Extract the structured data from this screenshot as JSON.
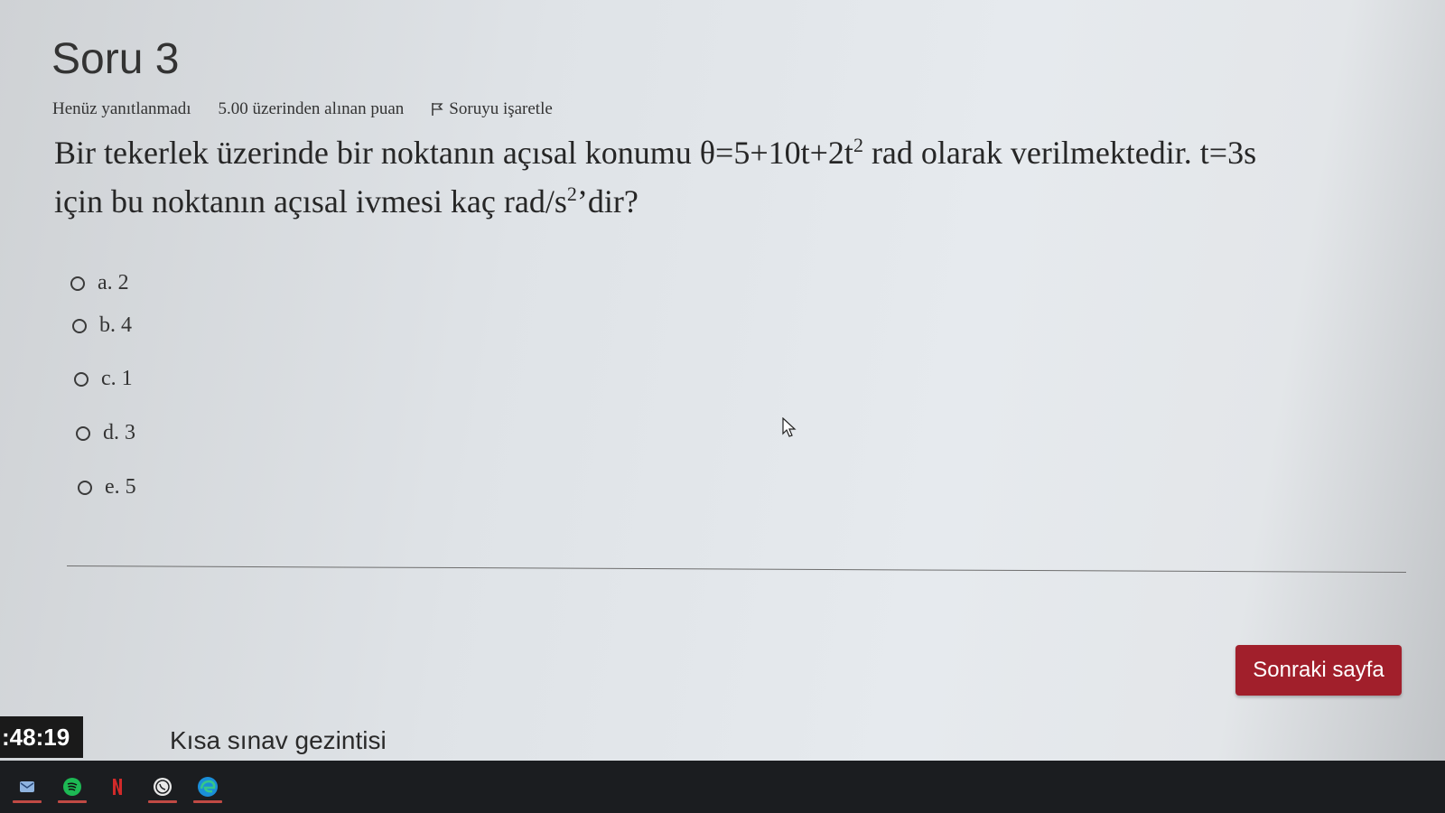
{
  "question": {
    "title": "Soru 3",
    "status": "Henüz yanıtlanmadı",
    "points": "5.00 üzerinden alınan puan",
    "flag_label": "Soruyu işaretle",
    "text_line1_a": "Bir tekerlek üzerinde bir noktanın açısal konumu θ=5+10t+2t",
    "text_line1_sup": "2",
    "text_line1_b": " rad olarak verilmektedir. t=3s",
    "text_line2_a": "için bu noktanın açısal ivmesi kaç rad/s",
    "text_line2_sup": "2",
    "text_line2_b": "’dir?"
  },
  "answers": [
    {
      "label": "a. 2"
    },
    {
      "label": "b. 4"
    },
    {
      "label": "c. 1"
    },
    {
      "label": "d. 3"
    },
    {
      "label": "e. 5"
    }
  ],
  "navigation": {
    "next_button": "Sonraki sayfa",
    "quiz_nav": "Kısa sınav gezintisi"
  },
  "timer": {
    "value": ":48:19"
  },
  "taskbar": {
    "apps": [
      "mail-icon",
      "spotify-icon",
      "netflix-icon",
      "whatsapp-icon",
      "edge-icon"
    ],
    "accent_color": "#c04a44"
  },
  "colors": {
    "primary_button": "#a11f2b",
    "timer_bg": "#1a1a1a",
    "taskbar_bg": "#1b1d20"
  }
}
